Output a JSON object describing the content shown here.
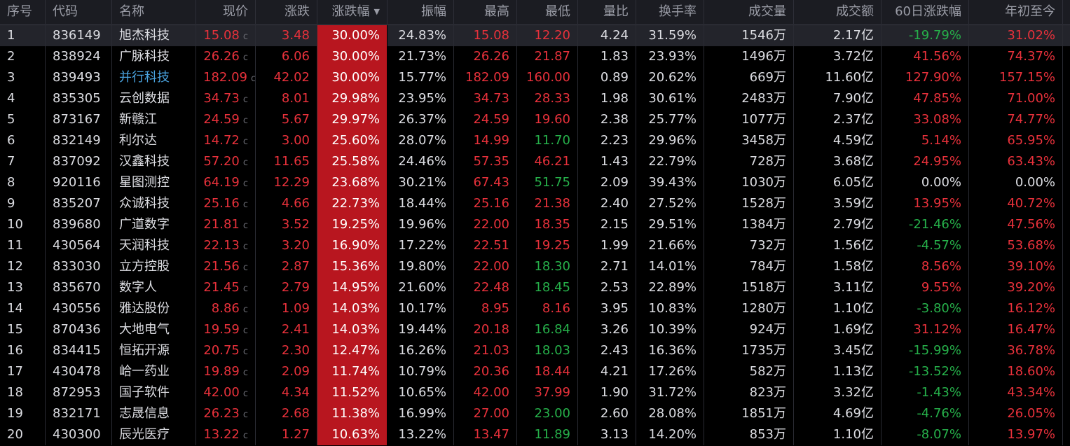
{
  "headers": {
    "seq": "序号",
    "code": "代码",
    "name": "名称",
    "price": "现价",
    "change": "涨跌",
    "change_pct": "涨跌幅",
    "amplitude": "振幅",
    "high": "最高",
    "low": "最低",
    "volume_ratio": "量比",
    "turnover": "换手率",
    "volume": "成交量",
    "amount": "成交额",
    "chg60": "60日涨跌幅",
    "ytd": "年初至今"
  },
  "sort_icon": "sort-desc-icon",
  "price_suffix": "c",
  "colors": {
    "up": "#e8313b",
    "down": "#26b04a",
    "flat": "#dcdde2",
    "highlight": "#b8161f",
    "link": "#4aa3df"
  },
  "rows": [
    {
      "seq": "1",
      "code": "836149",
      "name": "旭杰科技",
      "price": "15.08",
      "change": "3.48",
      "change_pct": "30.00%",
      "amplitude": "24.83%",
      "high": "15.08",
      "low": "12.20",
      "volume_ratio": "4.24",
      "turnover": "31.59%",
      "volume": "1546万",
      "amount": "2.17亿",
      "chg60": "-19.79%",
      "ytd": "31.02%",
      "name_color": "white",
      "high_color": "red",
      "low_color": "red",
      "chg60_color": "green",
      "ytd_color": "red",
      "selected": true
    },
    {
      "seq": "2",
      "code": "838924",
      "name": "广脉科技",
      "price": "26.26",
      "change": "6.06",
      "change_pct": "30.00%",
      "amplitude": "21.73%",
      "high": "26.26",
      "low": "21.87",
      "volume_ratio": "1.83",
      "turnover": "23.93%",
      "volume": "1496万",
      "amount": "3.72亿",
      "chg60": "41.56%",
      "ytd": "74.37%",
      "name_color": "white",
      "high_color": "red",
      "low_color": "red",
      "chg60_color": "red",
      "ytd_color": "red"
    },
    {
      "seq": "3",
      "code": "839493",
      "name": "并行科技",
      "price": "182.09",
      "change": "42.02",
      "change_pct": "30.00%",
      "amplitude": "15.77%",
      "high": "182.09",
      "low": "160.00",
      "volume_ratio": "0.89",
      "turnover": "20.62%",
      "volume": "669万",
      "amount": "11.60亿",
      "chg60": "127.90%",
      "ytd": "157.15%",
      "name_color": "blue",
      "high_color": "red",
      "low_color": "red",
      "chg60_color": "red",
      "ytd_color": "red"
    },
    {
      "seq": "4",
      "code": "835305",
      "name": "云创数据",
      "price": "34.73",
      "change": "8.01",
      "change_pct": "29.98%",
      "amplitude": "23.95%",
      "high": "34.73",
      "low": "28.33",
      "volume_ratio": "1.98",
      "turnover": "30.61%",
      "volume": "2483万",
      "amount": "7.90亿",
      "chg60": "47.85%",
      "ytd": "71.00%",
      "name_color": "white",
      "high_color": "red",
      "low_color": "red",
      "chg60_color": "red",
      "ytd_color": "red"
    },
    {
      "seq": "5",
      "code": "873167",
      "name": "新赣江",
      "price": "24.59",
      "change": "5.67",
      "change_pct": "29.97%",
      "amplitude": "26.37%",
      "high": "24.59",
      "low": "19.60",
      "volume_ratio": "2.38",
      "turnover": "25.77%",
      "volume": "1077万",
      "amount": "2.37亿",
      "chg60": "33.08%",
      "ytd": "74.77%",
      "name_color": "white",
      "high_color": "red",
      "low_color": "red",
      "chg60_color": "red",
      "ytd_color": "red"
    },
    {
      "seq": "6",
      "code": "832149",
      "name": "利尔达",
      "price": "14.72",
      "change": "3.00",
      "change_pct": "25.60%",
      "amplitude": "28.07%",
      "high": "14.99",
      "low": "11.70",
      "volume_ratio": "2.23",
      "turnover": "29.96%",
      "volume": "3458万",
      "amount": "4.59亿",
      "chg60": "5.14%",
      "ytd": "65.95%",
      "name_color": "white",
      "high_color": "red",
      "low_color": "green",
      "chg60_color": "red",
      "ytd_color": "red"
    },
    {
      "seq": "7",
      "code": "837092",
      "name": "汉鑫科技",
      "price": "57.20",
      "change": "11.65",
      "change_pct": "25.58%",
      "amplitude": "24.46%",
      "high": "57.35",
      "low": "46.21",
      "volume_ratio": "1.43",
      "turnover": "22.79%",
      "volume": "728万",
      "amount": "3.68亿",
      "chg60": "24.95%",
      "ytd": "63.43%",
      "name_color": "white",
      "high_color": "red",
      "low_color": "red",
      "chg60_color": "red",
      "ytd_color": "red"
    },
    {
      "seq": "8",
      "code": "920116",
      "name": "星图测控",
      "price": "64.19",
      "change": "12.29",
      "change_pct": "23.68%",
      "amplitude": "30.21%",
      "high": "67.43",
      "low": "51.75",
      "volume_ratio": "2.09",
      "turnover": "39.43%",
      "volume": "1030万",
      "amount": "6.05亿",
      "chg60": "0.00%",
      "ytd": "0.00%",
      "name_color": "white",
      "high_color": "red",
      "low_color": "green",
      "chg60_color": "white",
      "ytd_color": "white"
    },
    {
      "seq": "9",
      "code": "835207",
      "name": "众诚科技",
      "price": "25.16",
      "change": "4.66",
      "change_pct": "22.73%",
      "amplitude": "18.44%",
      "high": "25.16",
      "low": "21.38",
      "volume_ratio": "2.40",
      "turnover": "27.52%",
      "volume": "1528万",
      "amount": "3.59亿",
      "chg60": "13.95%",
      "ytd": "40.72%",
      "name_color": "white",
      "high_color": "red",
      "low_color": "red",
      "chg60_color": "red",
      "ytd_color": "red"
    },
    {
      "seq": "10",
      "code": "839680",
      "name": "广道数字",
      "price": "21.81",
      "change": "3.52",
      "change_pct": "19.25%",
      "amplitude": "19.96%",
      "high": "22.00",
      "low": "18.35",
      "volume_ratio": "2.15",
      "turnover": "29.51%",
      "volume": "1384万",
      "amount": "2.79亿",
      "chg60": "-21.46%",
      "ytd": "47.56%",
      "name_color": "white",
      "high_color": "red",
      "low_color": "red",
      "chg60_color": "green",
      "ytd_color": "red"
    },
    {
      "seq": "11",
      "code": "430564",
      "name": "天润科技",
      "price": "22.13",
      "change": "3.20",
      "change_pct": "16.90%",
      "amplitude": "17.22%",
      "high": "22.51",
      "low": "19.25",
      "volume_ratio": "1.99",
      "turnover": "21.66%",
      "volume": "732万",
      "amount": "1.56亿",
      "chg60": "-4.57%",
      "ytd": "53.68%",
      "name_color": "white",
      "high_color": "red",
      "low_color": "red",
      "chg60_color": "green",
      "ytd_color": "red"
    },
    {
      "seq": "12",
      "code": "833030",
      "name": "立方控股",
      "price": "21.56",
      "change": "2.87",
      "change_pct": "15.36%",
      "amplitude": "19.80%",
      "high": "22.00",
      "low": "18.30",
      "volume_ratio": "2.71",
      "turnover": "14.01%",
      "volume": "784万",
      "amount": "1.58亿",
      "chg60": "8.56%",
      "ytd": "39.10%",
      "name_color": "white",
      "high_color": "red",
      "low_color": "green",
      "chg60_color": "red",
      "ytd_color": "red"
    },
    {
      "seq": "13",
      "code": "835670",
      "name": "数字人",
      "price": "21.45",
      "change": "2.79",
      "change_pct": "14.95%",
      "amplitude": "21.60%",
      "high": "22.48",
      "low": "18.45",
      "volume_ratio": "2.53",
      "turnover": "22.89%",
      "volume": "1518万",
      "amount": "3.11亿",
      "chg60": "9.55%",
      "ytd": "39.20%",
      "name_color": "white",
      "high_color": "red",
      "low_color": "green",
      "chg60_color": "red",
      "ytd_color": "red"
    },
    {
      "seq": "14",
      "code": "430556",
      "name": "雅达股份",
      "price": "8.86",
      "change": "1.09",
      "change_pct": "14.03%",
      "amplitude": "10.17%",
      "high": "8.95",
      "low": "8.16",
      "volume_ratio": "3.95",
      "turnover": "10.83%",
      "volume": "1280万",
      "amount": "1.10亿",
      "chg60": "-3.80%",
      "ytd": "16.12%",
      "name_color": "white",
      "high_color": "red",
      "low_color": "red",
      "chg60_color": "green",
      "ytd_color": "red"
    },
    {
      "seq": "15",
      "code": "870436",
      "name": "大地电气",
      "price": "19.59",
      "change": "2.41",
      "change_pct": "14.03%",
      "amplitude": "19.44%",
      "high": "20.18",
      "low": "16.84",
      "volume_ratio": "3.26",
      "turnover": "10.39%",
      "volume": "924万",
      "amount": "1.69亿",
      "chg60": "31.12%",
      "ytd": "16.47%",
      "name_color": "white",
      "high_color": "red",
      "low_color": "green",
      "chg60_color": "red",
      "ytd_color": "red"
    },
    {
      "seq": "16",
      "code": "834415",
      "name": "恒拓开源",
      "price": "20.75",
      "change": "2.30",
      "change_pct": "12.47%",
      "amplitude": "16.26%",
      "high": "21.03",
      "low": "18.03",
      "volume_ratio": "2.43",
      "turnover": "16.36%",
      "volume": "1735万",
      "amount": "3.45亿",
      "chg60": "-15.99%",
      "ytd": "36.78%",
      "name_color": "white",
      "high_color": "red",
      "low_color": "green",
      "chg60_color": "green",
      "ytd_color": "red"
    },
    {
      "seq": "17",
      "code": "430478",
      "name": "峆一药业",
      "price": "19.89",
      "change": "2.09",
      "change_pct": "11.74%",
      "amplitude": "10.79%",
      "high": "20.36",
      "low": "18.44",
      "volume_ratio": "4.21",
      "turnover": "17.26%",
      "volume": "582万",
      "amount": "1.13亿",
      "chg60": "-13.52%",
      "ytd": "18.60%",
      "name_color": "white",
      "high_color": "red",
      "low_color": "red",
      "chg60_color": "green",
      "ytd_color": "red"
    },
    {
      "seq": "18",
      "code": "872953",
      "name": "国子软件",
      "price": "42.00",
      "change": "4.34",
      "change_pct": "11.52%",
      "amplitude": "10.65%",
      "high": "42.00",
      "low": "37.99",
      "volume_ratio": "1.90",
      "turnover": "31.72%",
      "volume": "823万",
      "amount": "3.32亿",
      "chg60": "-1.43%",
      "ytd": "43.34%",
      "name_color": "white",
      "high_color": "red",
      "low_color": "red",
      "chg60_color": "green",
      "ytd_color": "red"
    },
    {
      "seq": "19",
      "code": "832171",
      "name": "志晟信息",
      "price": "26.23",
      "change": "2.68",
      "change_pct": "11.38%",
      "amplitude": "16.99%",
      "high": "27.00",
      "low": "23.00",
      "volume_ratio": "2.60",
      "turnover": "28.08%",
      "volume": "1851万",
      "amount": "4.69亿",
      "chg60": "-4.76%",
      "ytd": "26.05%",
      "name_color": "white",
      "high_color": "red",
      "low_color": "green",
      "chg60_color": "green",
      "ytd_color": "red"
    },
    {
      "seq": "20",
      "code": "430300",
      "name": "辰光医疗",
      "price": "13.22",
      "change": "1.27",
      "change_pct": "10.63%",
      "amplitude": "13.22%",
      "high": "13.47",
      "low": "11.89",
      "volume_ratio": "3.13",
      "turnover": "14.20%",
      "volume": "853万",
      "amount": "1.10亿",
      "chg60": "-8.07%",
      "ytd": "13.97%",
      "name_color": "white",
      "high_color": "red",
      "low_color": "green",
      "chg60_color": "green",
      "ytd_color": "red"
    }
  ]
}
